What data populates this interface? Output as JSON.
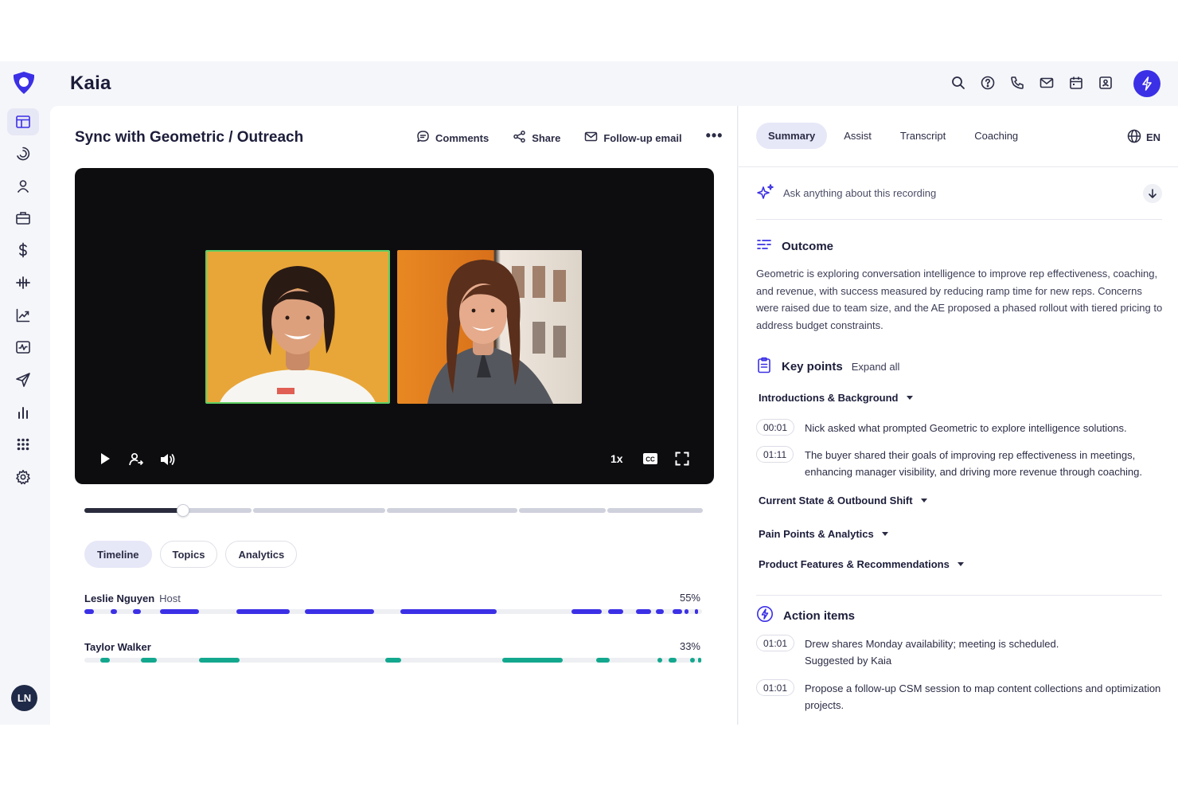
{
  "app": {
    "title": "Kaia",
    "accent": "#3b30e6",
    "user_initials": "LN"
  },
  "header_icons": [
    "search-icon",
    "help-icon",
    "phone-icon",
    "mail-icon",
    "calendar-icon",
    "contact-card-icon",
    "bolt-icon"
  ],
  "sidebar_icons": [
    "layout-icon",
    "activity-icon",
    "user-icon",
    "briefcase-icon",
    "dollar-icon",
    "waveform-icon",
    "trend-up-icon",
    "pulse-monitor-icon",
    "send-icon",
    "bar-chart-icon",
    "apps-grid-icon",
    "settings-icon"
  ],
  "main": {
    "title": "Sync with Geometric / Outreach",
    "actions": {
      "comments": "Comments",
      "share": "Share",
      "follow_up": "Follow-up email",
      "more": "•••"
    },
    "player": {
      "speed": "1x",
      "progress": 0.16
    },
    "tabs": [
      "Timeline",
      "Topics",
      "Analytics"
    ],
    "speakers": [
      {
        "name": "Leslie Nguyen",
        "role": "Host",
        "percent": "55%",
        "color": "#3b30e6",
        "segments": [
          [
            0,
            1.5
          ],
          [
            4.3,
            5.3
          ],
          [
            7.8,
            9.2
          ],
          [
            12.3,
            18.6
          ],
          [
            24.6,
            33.3
          ],
          [
            35.7,
            46.9
          ],
          [
            51.1,
            66.7
          ],
          [
            78.9,
            83.8
          ],
          [
            84.8,
            87.3
          ],
          [
            89.3,
            91.8
          ],
          [
            92.5,
            93.8
          ],
          [
            95.2,
            96.8
          ],
          [
            97.2,
            97.8
          ],
          [
            98.9,
            99.4
          ]
        ]
      },
      {
        "name": "Taylor Walker",
        "role": "",
        "percent": "33%",
        "color": "#13a88e",
        "segments": [
          [
            2.6,
            4.1
          ],
          [
            9.1,
            11.7
          ],
          [
            18.6,
            25.1
          ],
          [
            48.7,
            51.3
          ],
          [
            67.6,
            77.5
          ],
          [
            82.8,
            85.1
          ],
          [
            92.8,
            93.6
          ],
          [
            94.6,
            95.9
          ],
          [
            98.1,
            98.8
          ],
          [
            99.4,
            99.9
          ]
        ]
      }
    ]
  },
  "right": {
    "tabs": [
      "Summary",
      "Assist",
      "Transcript",
      "Coaching"
    ],
    "lang": "EN",
    "ask_placeholder": "Ask anything about this recording",
    "outcome": {
      "title": "Outcome",
      "text": "Geometric is exploring conversation intelligence to improve rep effectiveness, coaching, and revenue, with success measured by reducing ramp time for new reps. Concerns were raised due to team size, and the AE proposed a phased rollout with tiered pricing to address budget constraints."
    },
    "key_points": {
      "title": "Key points",
      "expand": "Expand all",
      "topics": [
        "Introductions & Background",
        "Current State & Outbound Shift",
        "Pain Points & Analytics",
        "Product Features & Recommendations"
      ],
      "items": [
        {
          "time": "00:01",
          "text": "Nick asked what prompted Geometric to explore intelligence solutions."
        },
        {
          "time": "01:11",
          "text": "The buyer shared their goals of improving rep effectiveness in meetings, enhancing manager visibility, and driving more revenue through coaching."
        }
      ]
    },
    "action_items": {
      "title": "Action items",
      "items": [
        {
          "time": "01:01",
          "text": "Drew shares Monday availability; meeting is scheduled.",
          "sub": "Suggested by Kaia"
        },
        {
          "time": "01:01",
          "text": "Propose a follow-up CSM session to map content collections and optimization projects.",
          "sub": ""
        }
      ]
    }
  }
}
